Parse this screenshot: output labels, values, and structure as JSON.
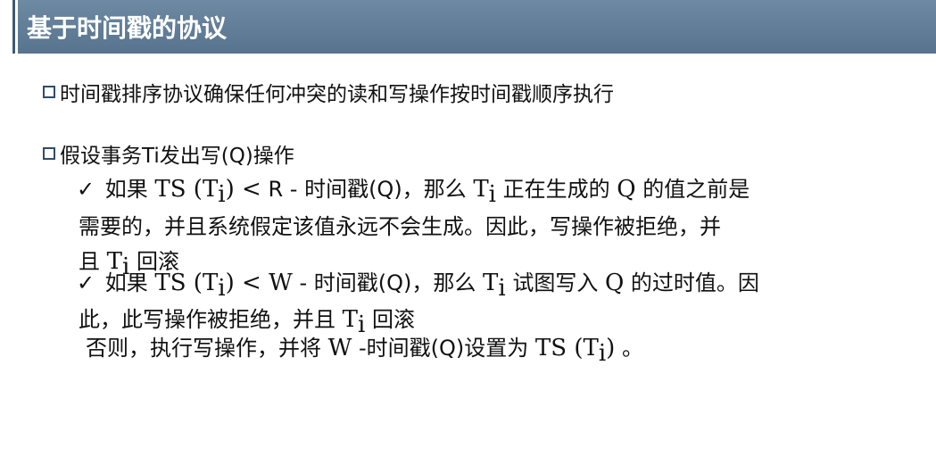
{
  "header": {
    "title": "基于时间戳的协议"
  },
  "bullets": [
    "时间戳排序协议确保任何冲突的读和写操作按时间戳顺序执行",
    "假设事务Ti发出写(Q)操作"
  ],
  "sub": {
    "check_glyph": "✓",
    "item1": {
      "p1": " 如果 ",
      "ts": "TS",
      "lparen": " (",
      "t": "T",
      "i": "i",
      "rparen": ") ",
      "lt": "<",
      "p2": " R - 时间戳(Q)，那么 ",
      "p3": " 正在生成的 ",
      "q": "Q",
      "p4": " 的值之前是",
      "line2": "需要的，并且系统假定该值永远不会生成。因此，写操作被拒绝，并",
      "line3_a": "且 ",
      "line3_b": " 回滚"
    },
    "item2": {
      "p1": " 如果 ",
      "ts": "TS",
      "lparen": " (",
      "t": "T",
      "i": "i",
      "rparen": ") ",
      "lt": "<",
      "w": " W",
      "p2": " - 时间戳(Q)，那么 ",
      "p3": " 试图写入 ",
      "q": "Q",
      "p4": " 的过时值。因",
      "line2_a": "此，此写操作被拒绝，并且 ",
      "line2_b": " 回滚"
    },
    "item3": {
      "p1": "否则，执行写操作，并将 ",
      "w": "W",
      "p2": " -时间戳(Q)设置为 ",
      "ts": "TS",
      "lparen": " (",
      "t": "T",
      "i": "i",
      "rparen": ")",
      "p3": " 。"
    }
  },
  "colors": {
    "title_bar": "#6e8aa3",
    "title_text": "#ffffff",
    "bullet_border": "#2e4d6b"
  }
}
